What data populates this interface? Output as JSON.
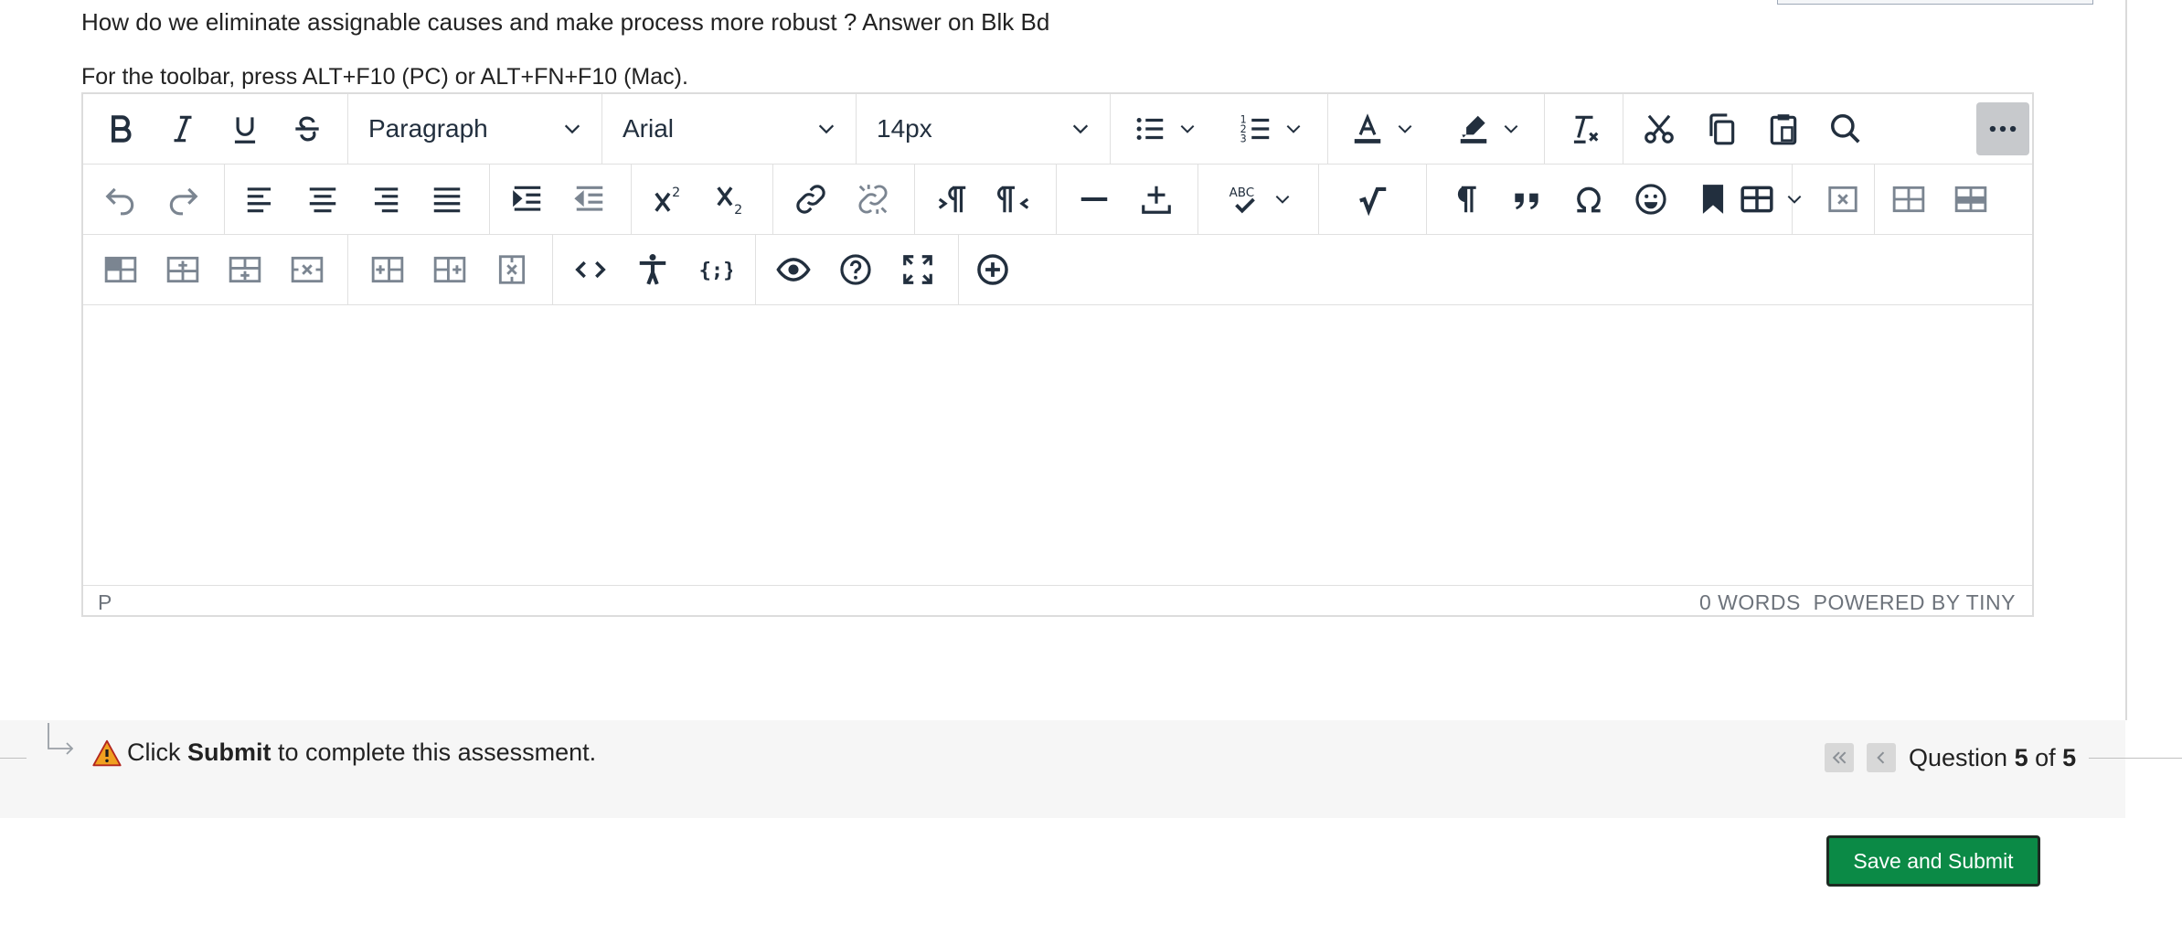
{
  "question": {
    "text": "How do we eliminate assignable causes and make process more robust ? Answer on Blk Bd"
  },
  "toolbar_hint": "For the toolbar, press ALT+F10 (PC) or ALT+FN+F10 (Mac).",
  "editor": {
    "block_format": "Paragraph",
    "font_family": "Arial",
    "font_size": "14px",
    "status_path": "P",
    "word_count": "0 WORDS",
    "powered_by": "POWERED BY TINY"
  },
  "footer": {
    "message_prefix": "Click ",
    "message_bold": "Submit",
    "message_suffix": " to complete this assessment.",
    "question_label": "Question ",
    "question_current": "5",
    "question_of": " of ",
    "question_total": "5",
    "save_submit": "Save and Submit"
  },
  "colors": {
    "toolbar_icon": "#222f3e",
    "save_button": "#0b8a46",
    "warning": "#f0a020"
  }
}
